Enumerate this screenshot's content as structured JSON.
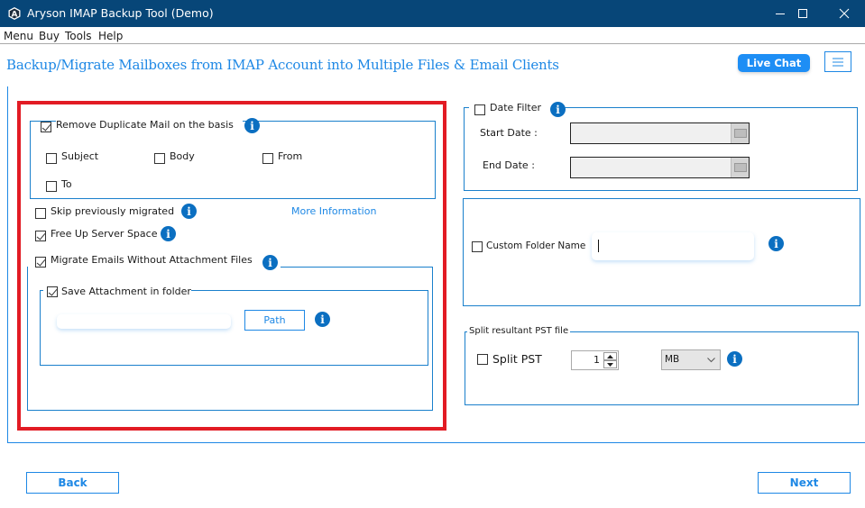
{
  "window": {
    "title": "Aryson IMAP Backup Tool (Demo)",
    "controls": [
      "minimize",
      "maximize",
      "close"
    ]
  },
  "menubar": {
    "items": [
      "Menu",
      "Buy",
      "Tools",
      "Help"
    ]
  },
  "header": {
    "title": "Backup/Migrate Mailboxes from IMAP Account into Multiple Files & Email Clients",
    "live_chat_label": "Live Chat"
  },
  "left_panel": {
    "remove_duplicate": {
      "label": "Remove Duplicate Mail on the basis",
      "checked": true,
      "options": [
        {
          "label": "Subject",
          "checked": false
        },
        {
          "label": "Body",
          "checked": false
        },
        {
          "label": "From",
          "checked": false
        },
        {
          "label": "To",
          "checked": false
        }
      ]
    },
    "skip_migrated": {
      "label": "Skip previously migrated",
      "checked": false
    },
    "more_info_link": "More Information",
    "free_up_space": {
      "label": "Free Up Server Space",
      "checked": true
    },
    "migrate_without_attachments": {
      "label": "Migrate Emails Without Attachment Files",
      "checked": true
    },
    "save_attachment": {
      "label": "Save Attachment in folder",
      "checked": true,
      "path_value": "",
      "path_button": "Path"
    }
  },
  "right_panel": {
    "date_filter": {
      "label": "Date Filter",
      "checked": false,
      "start_label": "Start Date :",
      "start_value": "",
      "end_label": "End Date :",
      "end_value": ""
    },
    "custom_folder": {
      "label": "Custom Folder Name",
      "checked": false,
      "value": ""
    },
    "split": {
      "group_title": "Split resultant PST file",
      "label": "Split PST",
      "checked": false,
      "size_value": "1",
      "unit_value": "MB"
    }
  },
  "footer": {
    "back_label": "Back",
    "next_label": "Next"
  },
  "colors": {
    "titlebar": "#074678",
    "accent": "#1e88e5",
    "highlight_box": "#e21b24",
    "info_icon": "#0b6fc1"
  }
}
